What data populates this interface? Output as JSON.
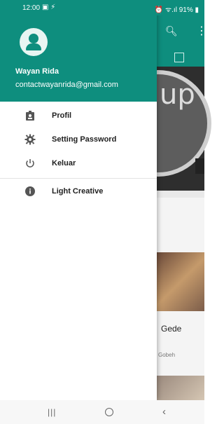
{
  "status_bar": {
    "time": "12:00",
    "left_icons": "▣ ⚡",
    "right": "⏰ ᯤ.ıl 91% ▮"
  },
  "drawer": {
    "user": {
      "name": "Wayan Rida",
      "email": "contactwayanrida@gmail.com"
    },
    "menu": [
      {
        "label": "Profil",
        "icon": "badge-icon"
      },
      {
        "label": "Setting Password",
        "icon": "gear-icon"
      },
      {
        "label": "Keluar",
        "icon": "power-icon"
      },
      {
        "label": "Light Creative",
        "icon": "info-icon"
      }
    ]
  },
  "background": {
    "card_title": "Gede",
    "card_subtitle": "Gobeh"
  },
  "colors": {
    "primary": "#0e8e7e"
  }
}
